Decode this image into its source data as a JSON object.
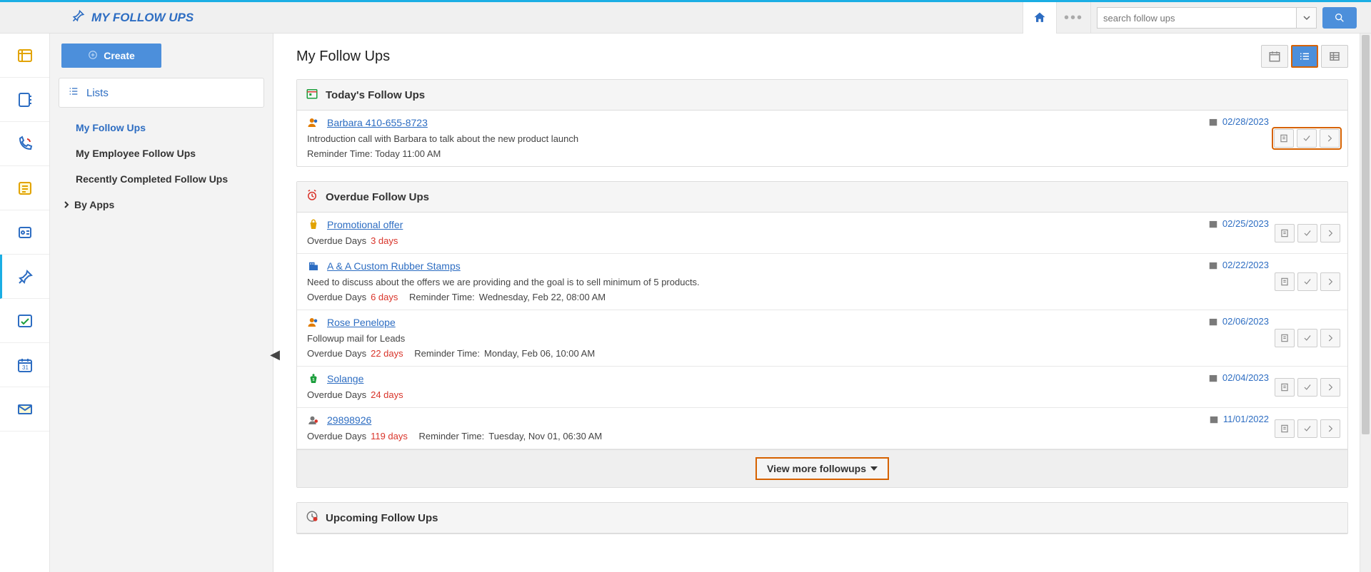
{
  "header": {
    "title": "MY FOLLOW UPS",
    "search_placeholder": "search follow ups"
  },
  "sidebar": {
    "create_label": "Create",
    "lists_label": "Lists",
    "items": [
      {
        "label": "My Follow Ups",
        "active": true
      },
      {
        "label": "My Employee Follow Ups"
      },
      {
        "label": "Recently Completed Follow Ups"
      }
    ],
    "by_apps_label": "By Apps"
  },
  "page": {
    "title": "My Follow Ups",
    "view_more_label": "View more followups"
  },
  "sections": {
    "today": {
      "title": "Today's Follow Ups",
      "rows": [
        {
          "link": "Barbara 410-655-8723",
          "date": "02/28/2023",
          "desc": "Introduction call with Barbara to talk about the new product launch",
          "reminder": "Reminder Time: Today 11:00 AM"
        }
      ]
    },
    "overdue": {
      "title": "Overdue Follow Ups",
      "label_overdue": "Overdue Days",
      "label_reminder": "Reminder Time:",
      "rows": [
        {
          "link": "Promotional offer",
          "date": "02/25/2023",
          "overdue": "3 days",
          "reminder": ""
        },
        {
          "link": "A & A Custom Rubber Stamps",
          "date": "02/22/2023",
          "desc": "Need to discuss about the offers we are providing and the goal is to sell minimum of 5 products.",
          "overdue": "6 days",
          "reminder": "Wednesday, Feb 22, 08:00 AM"
        },
        {
          "link": "Rose Penelope",
          "date": "02/06/2023",
          "desc": "Followup mail for Leads",
          "overdue": "22 days",
          "reminder": "Monday, Feb 06, 10:00 AM"
        },
        {
          "link": "Solange",
          "date": "02/04/2023",
          "overdue": "24 days",
          "reminder": ""
        },
        {
          "link": "29898926",
          "date": "11/01/2022",
          "overdue": "119 days",
          "reminder": "Tuesday, Nov 01, 06:30 AM"
        }
      ]
    },
    "upcoming": {
      "title": "Upcoming Follow Ups"
    }
  }
}
